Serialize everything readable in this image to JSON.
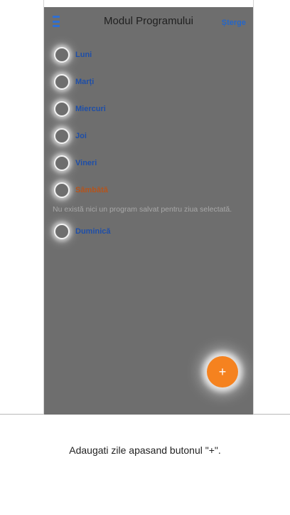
{
  "header": {
    "title": "Modul Programului",
    "delete_label": "Șterge"
  },
  "days": [
    {
      "label": "Luni",
      "selected": false
    },
    {
      "label": "Marți",
      "selected": false
    },
    {
      "label": "Miercuri",
      "selected": false
    },
    {
      "label": "Joi",
      "selected": false
    },
    {
      "label": "Vineri",
      "selected": false
    },
    {
      "label": "Sâmbătă",
      "selected": true
    },
    {
      "label": "Duminică",
      "selected": false
    }
  ],
  "empty_message": "Nu există nici un program salvat pentru ziua selectată.",
  "fab": {
    "label": "+",
    "icon": "plus-icon"
  },
  "hint": "Adaugati zile apasand butonul \"+\".",
  "colors": {
    "overlay": "#6e6e6e",
    "accent_blue": "#2566c8",
    "selected_orange": "#b5541c",
    "fab_orange": "#f5821f"
  }
}
